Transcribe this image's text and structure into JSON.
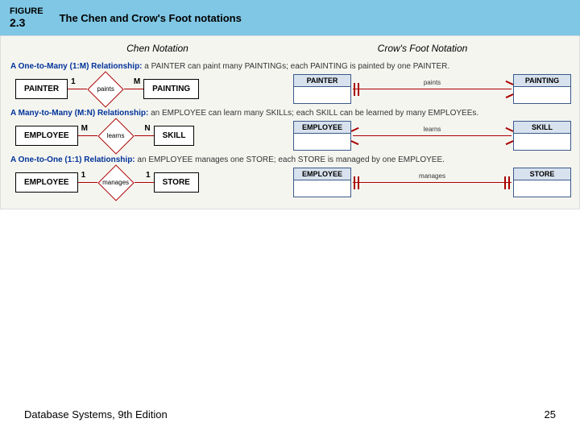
{
  "figure": {
    "label": "FIGURE",
    "number": "2.3",
    "title": "The Chen and Crow's Foot notations"
  },
  "columns": {
    "chen": "Chen Notation",
    "crow": "Crow's Foot Notation"
  },
  "rows": [
    {
      "desc_bold": "A One-to-Many (1:M) Relationship:",
      "desc_rest": " a PAINTER can paint many PAINTINGs; each PAINTING is painted by one PAINTER.",
      "chen": {
        "left": "PAINTER",
        "verb": "paints",
        "right": "PAINTING",
        "cl": "1",
        "cr": "M"
      },
      "crow": {
        "left": "PAINTER",
        "verb": "paints",
        "right": "PAINTING",
        "lsym": "one",
        "rsym": "many"
      }
    },
    {
      "desc_bold": "A Many-to-Many (M:N) Relationship:",
      "desc_rest": " an EMPLOYEE can learn many SKILLs; each SKILL can be learned by many EMPLOYEEs.",
      "chen": {
        "left": "EMPLOYEE",
        "verb": "learns",
        "right": "SKILL",
        "cl": "M",
        "cr": "N"
      },
      "crow": {
        "left": "EMPLOYEE",
        "verb": "learns",
        "right": "SKILL",
        "lsym": "many",
        "rsym": "many"
      }
    },
    {
      "desc_bold": "A One-to-One (1:1) Relationship:",
      "desc_rest": " an EMPLOYEE manages one STORE; each STORE is managed by one EMPLOYEE.",
      "chen": {
        "left": "EMPLOYEE",
        "verb": "manages",
        "right": "STORE",
        "cl": "1",
        "cr": "1"
      },
      "crow": {
        "left": "EMPLOYEE",
        "verb": "manages",
        "right": "STORE",
        "lsym": "one",
        "rsym": "one"
      }
    }
  ],
  "footer": {
    "left": "Database Systems, 9th Edition",
    "right": "25"
  }
}
